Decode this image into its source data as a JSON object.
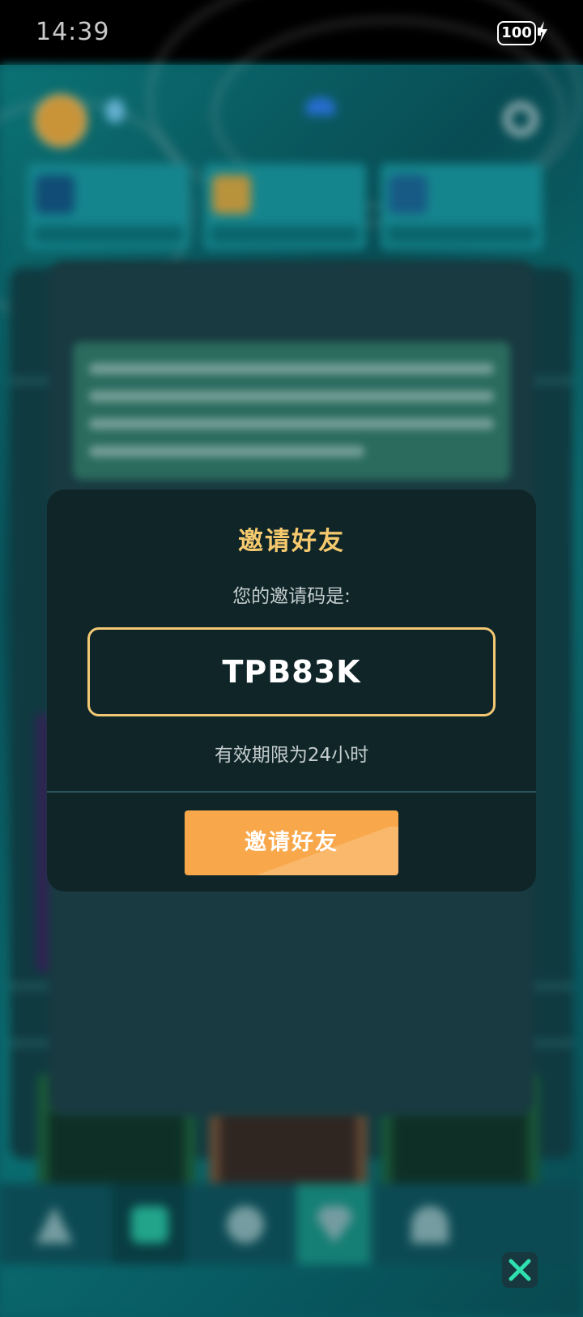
{
  "status_bar": {
    "time": "14:39",
    "battery": "100"
  },
  "invite_modal": {
    "title": "邀请好友",
    "code_label": "您的邀请码是:",
    "code": "TPB83K",
    "validity": "有效期限为24小时",
    "invite_button": "邀请好友"
  },
  "colors": {
    "accent_gold": "#f5c96e",
    "button_orange": "#f8a84b",
    "modal_bg": "#0f2528"
  },
  "icons": [
    "gear-icon",
    "bolt-icon",
    "close-icon"
  ]
}
